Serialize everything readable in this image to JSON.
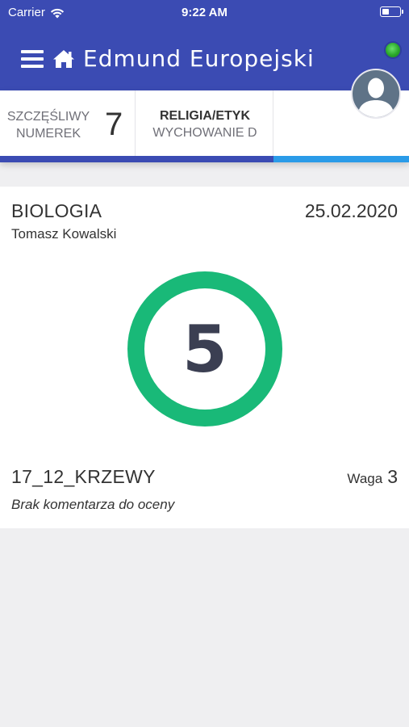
{
  "status_bar": {
    "carrier": "Carrier",
    "time": "9:22 AM"
  },
  "header": {
    "title": "Edmund Europejski",
    "online_color": "#2aa82a",
    "accent_color": "#3b4bb3"
  },
  "info": {
    "lucky_label_line1": "SZCZĘŚLIWY",
    "lucky_label_line2": "NUMEREK",
    "lucky_number": "7",
    "lesson_title": "RELIGIA/ETYK",
    "lesson_sub": "WYCHOWANIE D"
  },
  "grade": {
    "subject": "BIOLOGIA",
    "date": "25.02.2020",
    "teacher": "Tomasz Kowalski",
    "value": "5",
    "ring_color": "#19b978",
    "description": "17_12_KRZEWY",
    "weight_label": "Waga",
    "weight_value": "3",
    "comment": "Brak komentarza do oceny"
  },
  "icons": [
    "menu-icon",
    "home-icon",
    "wifi-icon",
    "battery-icon",
    "avatar-icon"
  ]
}
